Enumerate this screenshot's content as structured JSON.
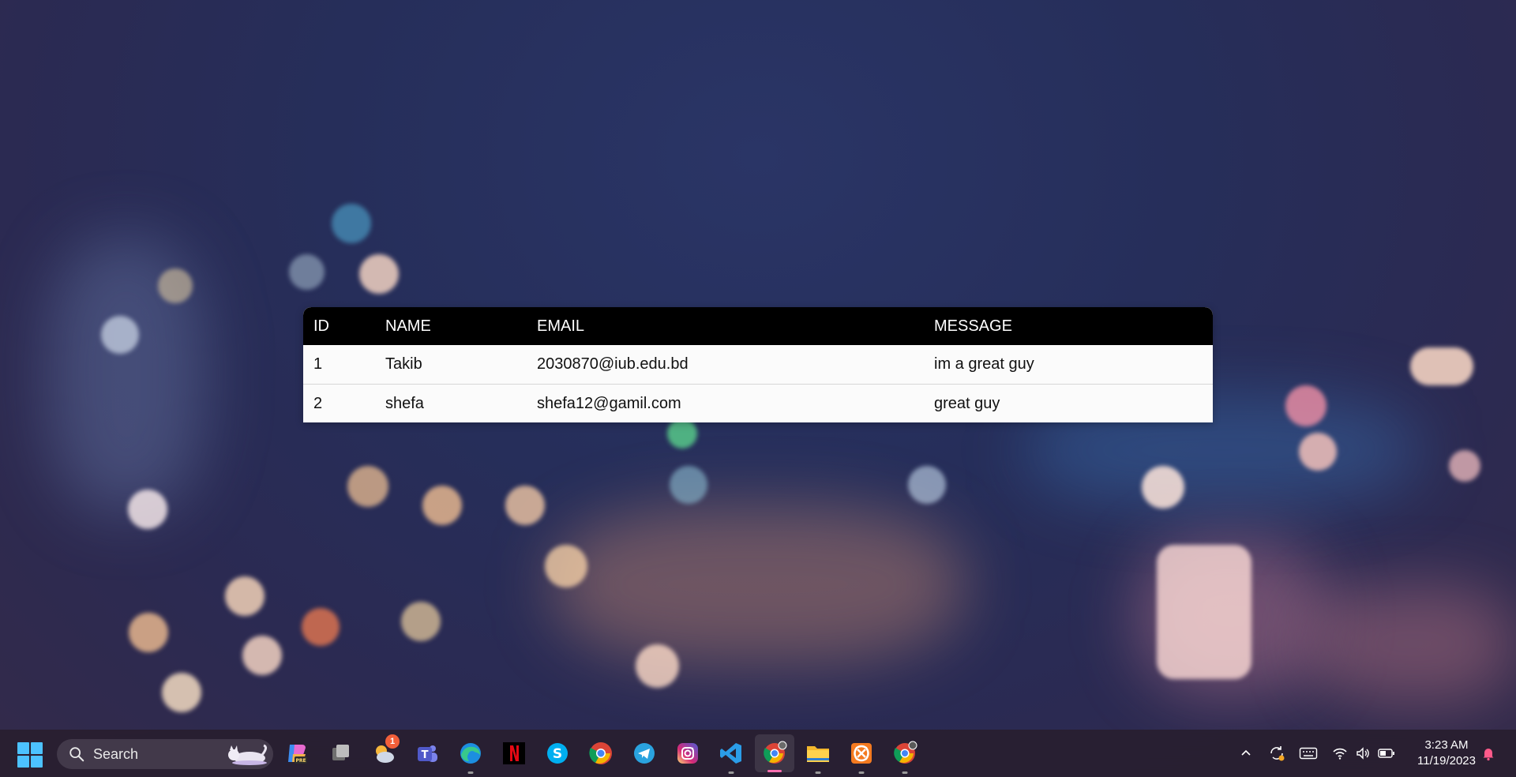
{
  "table": {
    "headers": [
      "ID",
      "NAME",
      "EMAIL",
      "MESSAGE"
    ],
    "rows": [
      {
        "id": "1",
        "name": "Takib",
        "email": "2030870@iub.edu.bd",
        "message": "im a great guy"
      },
      {
        "id": "2",
        "name": "shefa",
        "email": "shefa12@gamil.com",
        "message": "great guy"
      }
    ]
  },
  "taskbar": {
    "search_label": "Search",
    "weather_badge": "1",
    "apps": [
      "copilot-icon",
      "task-view-icon",
      "widgets-icon",
      "teams-icon",
      "edge-icon",
      "netflix-icon",
      "skype-icon",
      "chrome-icon",
      "telegram-icon",
      "instagram-icon",
      "vscode-icon",
      "chrome-profile-icon",
      "file-explorer-icon",
      "xampp-icon",
      "chrome-profile-2-icon"
    ],
    "clock": {
      "time": "3:23 AM",
      "date": "11/19/2023"
    }
  },
  "colors": {
    "accent": "#4cc2ff",
    "table_header": "#000000",
    "active_indicator": "#ff6fb1"
  }
}
